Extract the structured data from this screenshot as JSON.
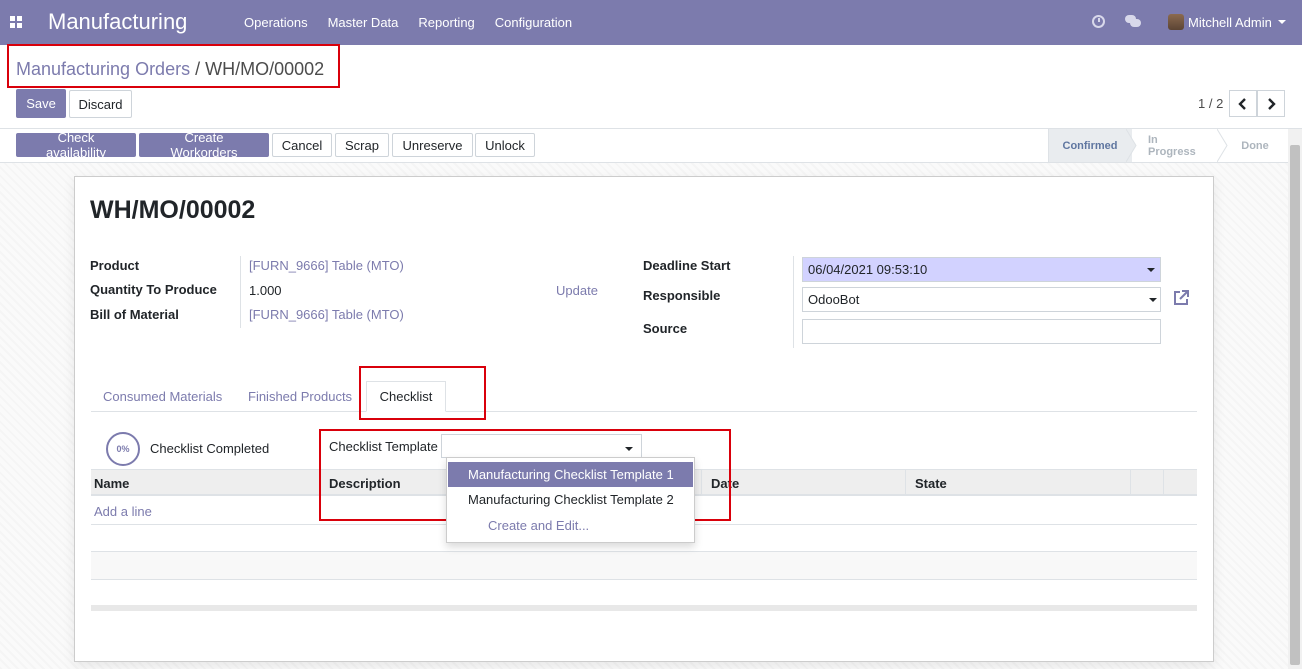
{
  "navbar": {
    "app_name": "Manufacturing",
    "menu": [
      "Operations",
      "Master Data",
      "Reporting",
      "Configuration"
    ],
    "user": "Mitchell Admin"
  },
  "breadcrumb": {
    "parent": "Manufacturing Orders",
    "separator": "/",
    "current": "WH/MO/00002"
  },
  "control": {
    "save": "Save",
    "discard": "Discard",
    "pager": "1 / 2"
  },
  "actions": {
    "check_availability": "Check availability",
    "create_workorders": "Create Workorders",
    "cancel": "Cancel",
    "scrap": "Scrap",
    "unreserve": "Unreserve",
    "unlock": "Unlock"
  },
  "status": {
    "steps": [
      "Confirmed",
      "In Progress",
      "Done"
    ],
    "active": "Confirmed"
  },
  "form": {
    "title": "WH/MO/00002",
    "product_label": "Product",
    "product_value": "[FURN_9666] Table (MTO)",
    "qty_label": "Quantity To Produce",
    "qty_value": "1.000",
    "update_link": "Update",
    "bom_label": "Bill of Material",
    "bom_value": "[FURN_9666] Table (MTO)",
    "deadline_label": "Deadline Start",
    "deadline_value": "06/04/2021 09:53:10",
    "responsible_label": "Responsible",
    "responsible_value": "OdooBot",
    "source_label": "Source",
    "source_value": ""
  },
  "tabs": [
    "Consumed Materials",
    "Finished Products",
    "Checklist"
  ],
  "checklist": {
    "progress": "0%",
    "completed_label": "Checklist Completed",
    "template_label": "Checklist Template",
    "template_value": "",
    "columns": [
      "Name",
      "Description",
      "Date",
      "State"
    ],
    "add_line": "Add a line"
  },
  "dropdown": {
    "options": [
      "Manufacturing Checklist Template 1",
      "Manufacturing Checklist Template 2"
    ],
    "selected": "Manufacturing Checklist Template 1",
    "create_edit": "Create and Edit..."
  },
  "colors": {
    "brand": "#7c7bad",
    "highlight_box": "#d9000b",
    "required_field": "#d2d2ff"
  }
}
